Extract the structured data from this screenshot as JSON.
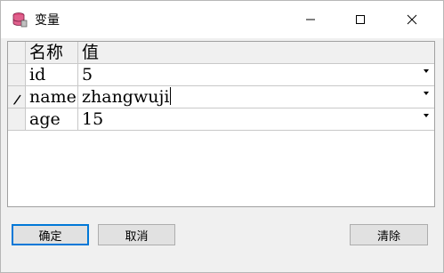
{
  "window": {
    "title": "变量",
    "icon": "database-icon",
    "controls": [
      "minimize-icon",
      "maximize-icon",
      "close-icon"
    ]
  },
  "grid": {
    "columns": [
      "名称",
      "值"
    ],
    "rows": [
      {
        "name": "id",
        "value": "5",
        "editing": false
      },
      {
        "name": "name",
        "value": "zhangwuji",
        "editing": true
      },
      {
        "name": "age",
        "value": "15",
        "editing": false
      }
    ]
  },
  "buttons": {
    "ok": "确定",
    "cancel": "取消",
    "clear": "清除"
  },
  "colors": {
    "accent": "#0078d7",
    "window_bg": "#f0f0f0"
  }
}
